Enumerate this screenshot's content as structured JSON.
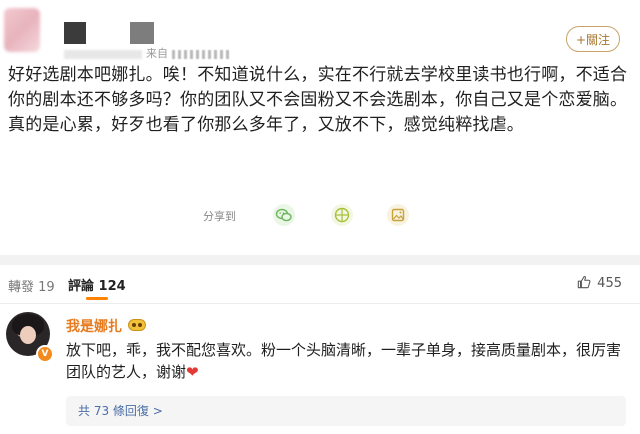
{
  "post": {
    "meta_source": "来自",
    "follow_label": "+關注",
    "text": "好好选剧本吧娜扎。唉！不知道说什么，实在不行就去学校里读书也行啊，不适合你的剧本还不够多吗？你的团队又不会固粉又不会选剧本，你自己又是个恋爱脑。真的是心累，好歹也看了你那么多年了，又放不下，感觉纯粹找虐。",
    "share_label": "分享到",
    "share_icons": [
      "wechat-icon",
      "moments-icon",
      "image-share-icon"
    ]
  },
  "tabs": {
    "reposts": "轉發 19",
    "comments": "評論 124",
    "likes": "455"
  },
  "comment": {
    "author": "我是娜扎",
    "verified_badge": "V",
    "text": "放下吧，乖，我不配您喜欢。粉一个头脑清晰，一辈子单身，接高质量剧本，很厉害团队的艺人，谢谢",
    "heart": "❤",
    "replies": "共 73 條回復 >"
  },
  "colors": {
    "accent": "#ff8200",
    "follow": "#a7762d",
    "name": "#e77b1f",
    "link": "#4a6ea8"
  }
}
